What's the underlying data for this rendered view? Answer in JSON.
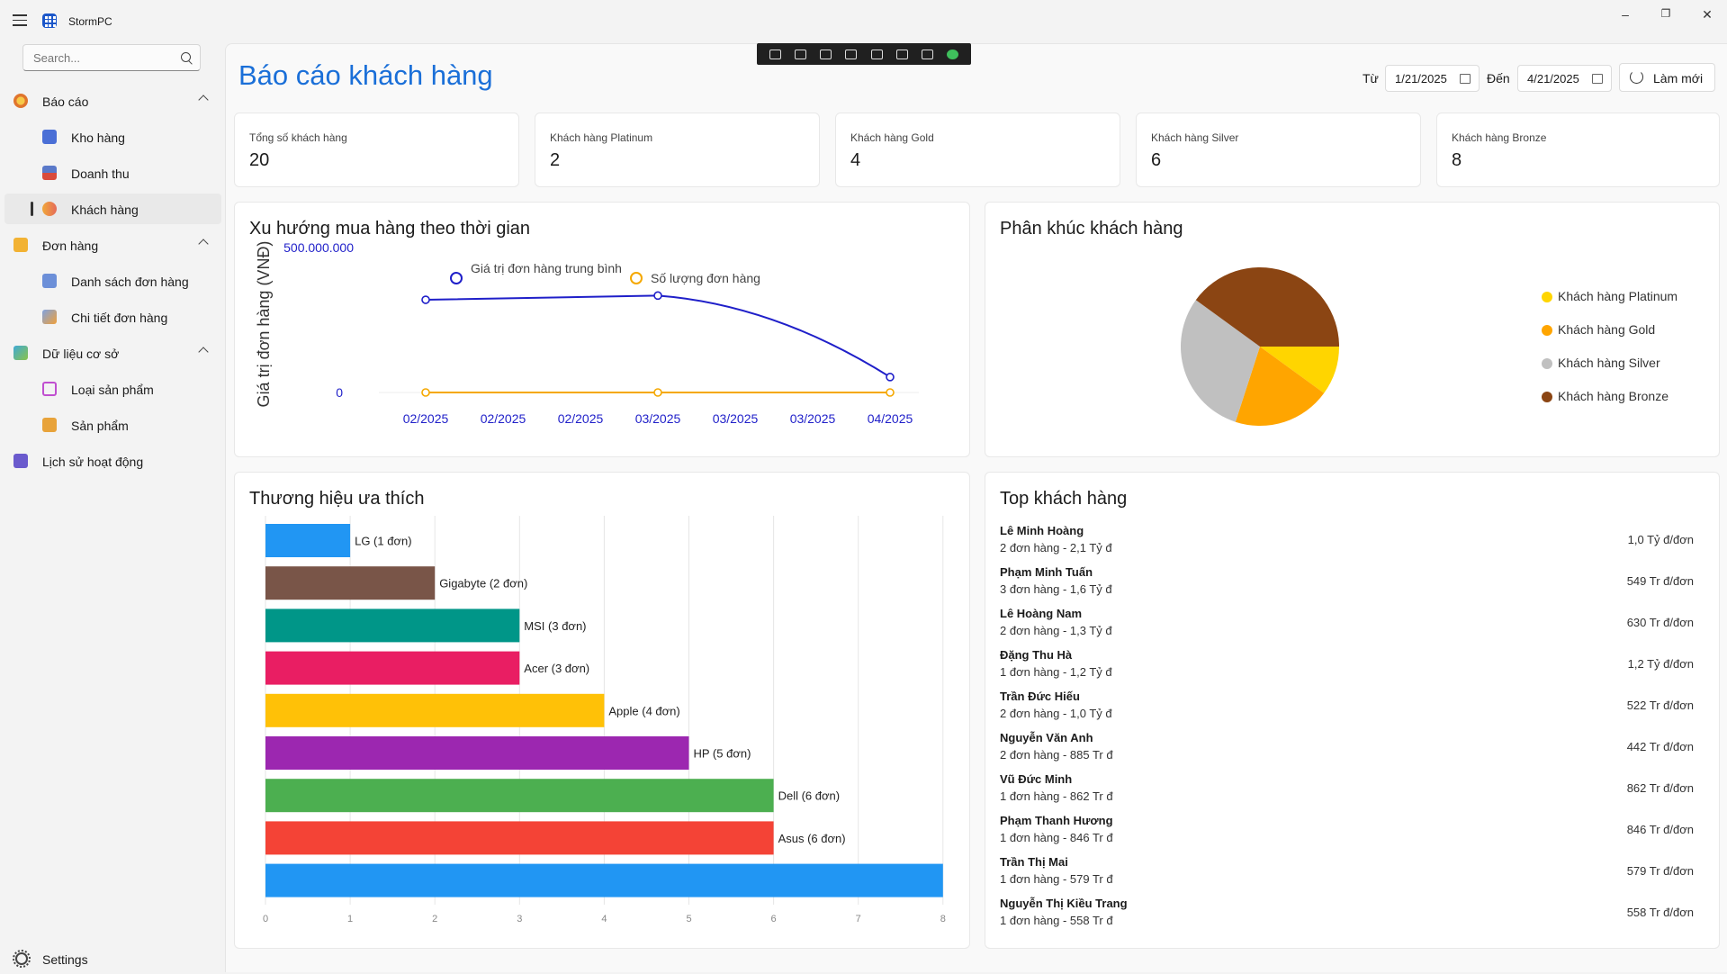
{
  "app": {
    "title": "StormPC"
  },
  "search": {
    "placeholder": "Search..."
  },
  "sidebar": {
    "groups": [
      {
        "label": "Báo cáo",
        "items": [
          {
            "label": "Kho hàng"
          },
          {
            "label": "Doanh thu"
          },
          {
            "label": "Khách hàng"
          }
        ]
      },
      {
        "label": "Đơn hàng",
        "items": [
          {
            "label": "Danh sách đơn hàng"
          },
          {
            "label": "Chi tiết đơn hàng"
          }
        ]
      },
      {
        "label": "Dữ liệu cơ sở",
        "items": [
          {
            "label": "Loại sản phẩm"
          },
          {
            "label": "Sản phẩm"
          }
        ]
      },
      {
        "label": "Lịch sử hoạt động",
        "items": []
      }
    ],
    "active_item": "Khách hàng",
    "settings_label": "Settings"
  },
  "header": {
    "title": "Báo cáo khách hàng",
    "from_label": "Từ",
    "from_date": "1/21/2025",
    "to_label": "Đến",
    "to_date": "4/21/2025",
    "refresh_label": "Làm mới"
  },
  "stats": [
    {
      "label": "Tổng số khách hàng",
      "value": "20"
    },
    {
      "label": "Khách hàng Platinum",
      "value": "2"
    },
    {
      "label": "Khách hàng Gold",
      "value": "4"
    },
    {
      "label": "Khách hàng Silver",
      "value": "6"
    },
    {
      "label": "Khách hàng Bronze",
      "value": "8"
    }
  ],
  "trend": {
    "title": "Xu hướng mua hàng theo thời gian"
  },
  "segments": {
    "title": "Phân khúc khách hàng"
  },
  "brands": {
    "title": "Thương hiệu ưa thích"
  },
  "top": {
    "title": "Top khách hàng",
    "customers": [
      {
        "name": "Lê Minh Hoàng",
        "orders": "2",
        "total": "2,1 Tỷ",
        "avg": "1,0 Tỷ"
      },
      {
        "name": "Phạm Minh Tuấn",
        "orders": "3",
        "total": "1,6 Tỷ",
        "avg": "549 Tr"
      },
      {
        "name": "Lê Hoàng Nam",
        "orders": "2",
        "total": "1,3 Tỷ",
        "avg": "630 Tr"
      },
      {
        "name": "Đặng Thu Hà",
        "orders": "1",
        "total": "1,2 Tỷ",
        "avg": "1,2 Tỷ"
      },
      {
        "name": "Trần Đức Hiếu",
        "orders": "2",
        "total": "1,0 Tỷ",
        "avg": "522 Tr"
      },
      {
        "name": "Nguyễn Văn Anh",
        "orders": "2",
        "total": "885 Tr",
        "avg": "442 Tr"
      },
      {
        "name": "Vũ Đức Minh",
        "orders": "1",
        "total": "862 Tr",
        "avg": "862 Tr"
      },
      {
        "name": "Phạm Thanh Hương",
        "orders": "1",
        "total": "846 Tr",
        "avg": "846 Tr"
      },
      {
        "name": "Trần Thị Mai",
        "orders": "1",
        "total": "579 Tr",
        "avg": "579 Tr"
      },
      {
        "name": "Nguyễn Thị Kiều Trang",
        "orders": "1",
        "total": "558 Tr",
        "avg": "558 Tr"
      }
    ],
    "orders_word": "đơn hàng -",
    "currency": "đ",
    "per_order": "đ/đơn"
  },
  "chart_data": [
    {
      "type": "line",
      "title": "Xu hướng mua hàng theo thời gian",
      "ylabel": "Giá trị đơn hàng (VNĐ)",
      "x": [
        "02/2025",
        "02/2025",
        "02/2025",
        "03/2025",
        "03/2025",
        "03/2025",
        "04/2025"
      ],
      "y_ticks": [
        "0",
        "500.000.000"
      ],
      "series": [
        {
          "name": "Giá trị đơn hàng trung bình",
          "color": "#1f1fc9",
          "points": [
            [
              0,
              330000000
            ],
            [
              3,
              345000000
            ],
            [
              6,
              55000000
            ]
          ]
        },
        {
          "name": "Số lượng đơn hàng",
          "color": "#f5a800",
          "points": [
            [
              0,
              0
            ],
            [
              3,
              0
            ],
            [
              6,
              0
            ]
          ]
        }
      ]
    },
    {
      "type": "pie",
      "title": "Phân khúc khách hàng",
      "legend": "right",
      "slices": [
        {
          "label": "Khách hàng Platinum",
          "value": 2,
          "color": "#ffd500"
        },
        {
          "label": "Khách hàng Gold",
          "value": 4,
          "color": "#ffa500"
        },
        {
          "label": "Khách hàng Silver",
          "value": 6,
          "color": "#c0c0c0"
        },
        {
          "label": "Khách hàng Bronze",
          "value": 8,
          "color": "#8b4513"
        }
      ]
    },
    {
      "type": "bar",
      "orientation": "horizontal",
      "title": "Thương hiệu ưa thích",
      "categories": [
        "LG (1 đơn)",
        "Gigabyte (2 đơn)",
        "MSI (3 đơn)",
        "Acer (3 đơn)",
        "Apple (4 đơn)",
        "HP (5 đơn)",
        "Dell (6 đơn)",
        "Asus (6 đơn)",
        ""
      ],
      "values": [
        1,
        2,
        3,
        3,
        4,
        5,
        6,
        6,
        8
      ],
      "colors": [
        "#2196f3",
        "#795548",
        "#009688",
        "#e91e63",
        "#ffc107",
        "#9c27b0",
        "#4caf50",
        "#f44336",
        "#2196f3"
      ],
      "xlim": [
        0,
        8
      ],
      "x_ticks": [
        "0",
        "1",
        "2",
        "3",
        "4",
        "5",
        "6",
        "7",
        "8"
      ],
      "grid": true
    }
  ]
}
